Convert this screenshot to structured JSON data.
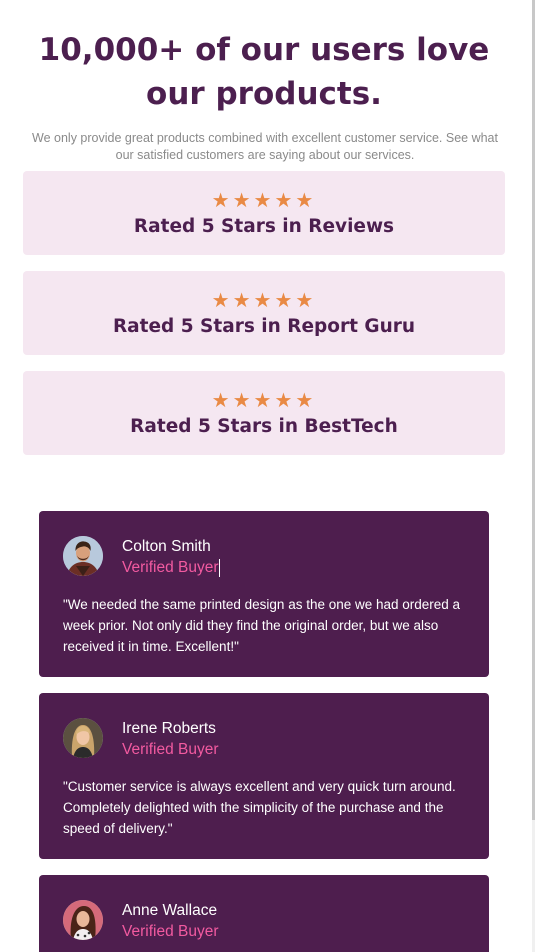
{
  "header": {
    "headline": "10,000+ of our users love our products.",
    "subtitle": "We only provide great products combined with excellent customer service. See what our satisfied customers are saying about our services."
  },
  "ratings": [
    {
      "stars": "★★★★★",
      "label": "Rated 5 Stars in Reviews",
      "rating": 5
    },
    {
      "stars": "★★★★★",
      "label": "Rated 5 Stars in Report Guru",
      "rating": 5
    },
    {
      "stars": "★★★★★",
      "label": "Rated 5 Stars in BestTech",
      "rating": 5
    }
  ],
  "reviews": [
    {
      "name": "Colton Smith",
      "status": "Verified Buyer",
      "quote": "\"We needed the same printed design as the one we had ordered a week prior. Not only did they find the original order, but we also received it in time. Excellent!\""
    },
    {
      "name": "Irene Roberts",
      "status": "Verified Buyer",
      "quote": "\"Customer service is always excellent and very quick turn around. Completely delighted with the simplicity of the purchase and the speed of delivery.\""
    },
    {
      "name": "Anne Wallace",
      "status": "Verified Buyer",
      "quote": ""
    }
  ],
  "colors": {
    "heading": "#4c1f4f",
    "star": "#e98a45",
    "rating_card_bg": "#f5e7f1",
    "review_card_bg": "#4e1e4e",
    "verified": "#f25aa0"
  }
}
